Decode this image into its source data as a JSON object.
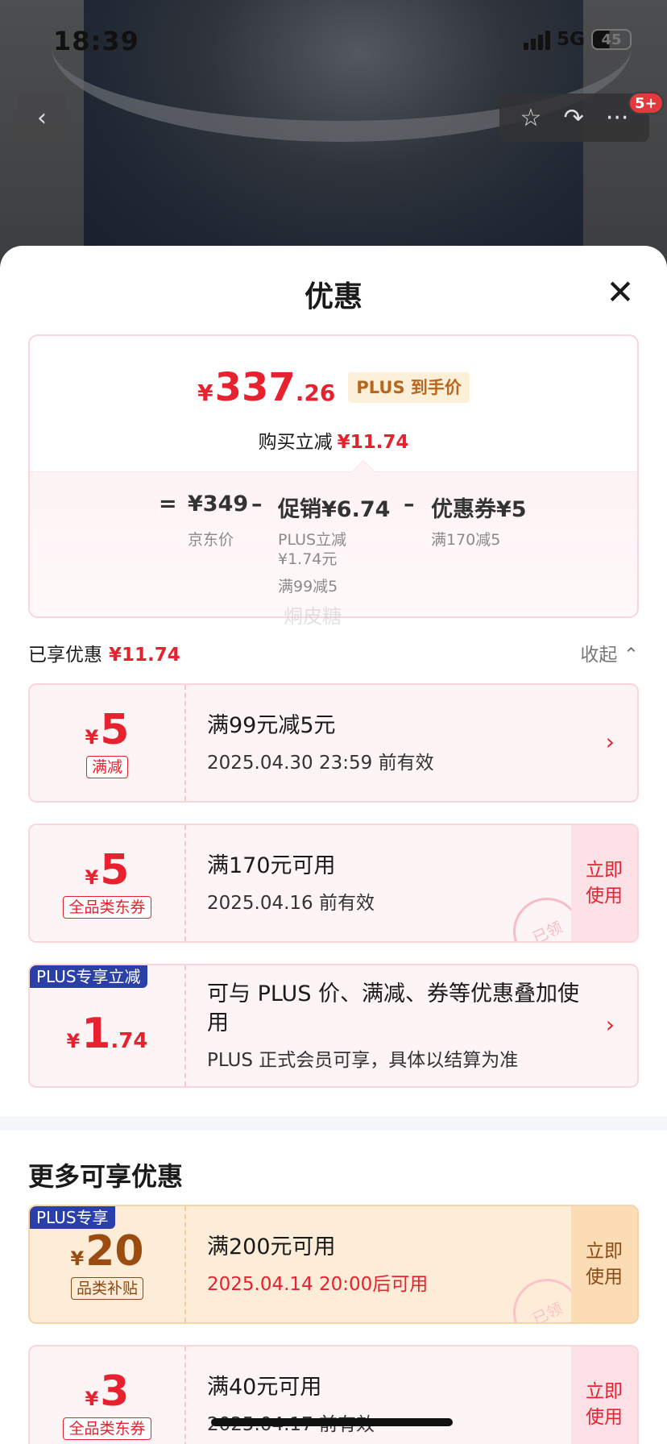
{
  "status_bar": {
    "time": "18:39",
    "network": "5G",
    "battery": "45"
  },
  "header_actions": {
    "badge": "5+"
  },
  "sheet": {
    "title": "优惠"
  },
  "price_card": {
    "currency": "¥",
    "price_int": "337",
    "price_dec": ".26",
    "plus_tag": "PLUS 到手价",
    "reduce_label": "购买立减",
    "reduce_amount": "¥11.74",
    "formula": {
      "equals": "=",
      "jd_price": "¥349",
      "jd_price_label": "京东价",
      "minus1": "–",
      "promo": "促销¥6.74",
      "promo_sub1": "PLUS立减",
      "promo_sub2": "¥1.74元",
      "promo_sub3": "满99减5",
      "minus2": "–",
      "coupon": "优惠券¥5",
      "coupon_sub": "满170减5"
    }
  },
  "enjoyed": {
    "label": "已享优惠",
    "amount": "¥11.74",
    "collapse": "收起"
  },
  "watermark": "烔皮糖",
  "coupons": [
    {
      "yen": "¥",
      "amount": "5",
      "tag": "满减",
      "title": "满99元减5元",
      "validity": "2025.04.30 23:59 前有效"
    },
    {
      "yen": "¥",
      "amount": "5",
      "tag": "全品类东券",
      "title": "满170元可用",
      "validity": "2025.04.16 前有效",
      "button": "立即使用",
      "stamp": "已领"
    },
    {
      "flag": "PLUS专享立减",
      "yen": "¥",
      "amount": "1",
      "decimal": ".74",
      "title": "可与 PLUS 价、满减、券等优惠叠加使用",
      "validity": "PLUS 正式会员可享，具体以结算为准"
    }
  ],
  "more_section": {
    "title": "更多可享优惠"
  },
  "more_coupons": [
    {
      "flag": "PLUS专享",
      "yen": "¥",
      "amount": "20",
      "tag": "品类补贴",
      "title": "满200元可用",
      "validity": "2025.04.14 20:00后可用",
      "button": "立即使用",
      "stamp": "已领"
    },
    {
      "yen": "¥",
      "amount": "3",
      "tag": "全品类东券",
      "title": "满40元可用",
      "validity": "2025.04.17 前有效",
      "button": "立即使用"
    }
  ],
  "colors": {
    "accent": "#e8212f",
    "plus_blue": "#2b3fa8",
    "gold": "#9a4c11"
  },
  "icons": [
    "back-icon",
    "star-icon",
    "share-icon",
    "more-icon",
    "close-icon",
    "chevron-up-icon",
    "chevron-right-icon"
  ]
}
